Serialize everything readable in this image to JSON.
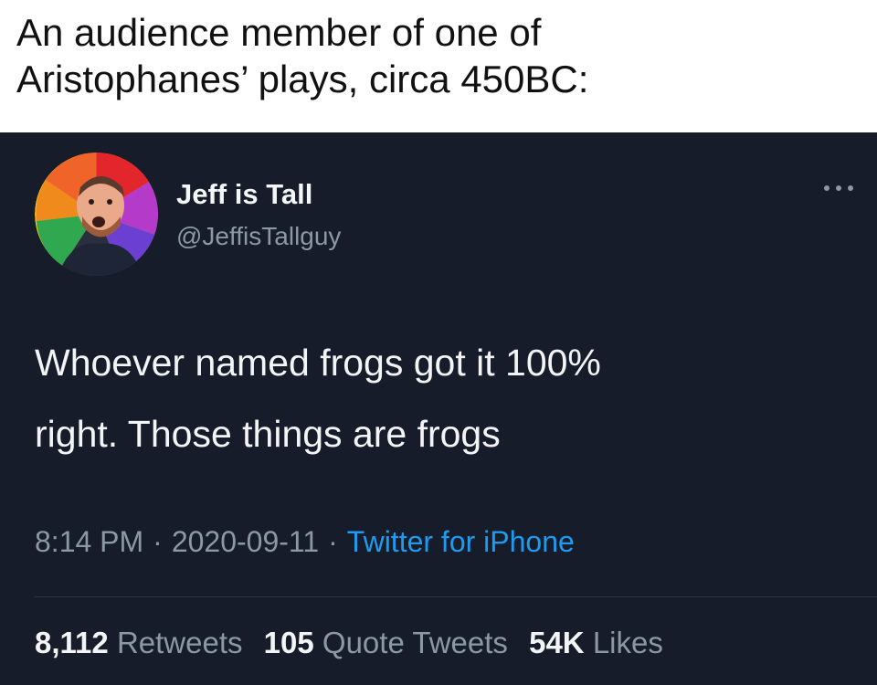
{
  "caption": {
    "line1": "An audience member of one of",
    "line2": "Aristophanes’ plays, circa 450BC:"
  },
  "tweet": {
    "display_name": "Jeff is Tall",
    "handle": "@JeffisTallguy",
    "more_icon": "ellipsis-icon",
    "text_line1": "Whoever named frogs got it 100%",
    "text_line2": "right. Those things are frogs",
    "time": "8:14 PM",
    "date": "2020-09-11",
    "separator": "·",
    "source": "Twitter for iPhone",
    "stats": {
      "retweets_count": "8,112",
      "retweets_label": "Retweets",
      "quotes_count": "105",
      "quotes_label": "Quote Tweets",
      "likes_count": "54K",
      "likes_label": "Likes"
    }
  },
  "colors": {
    "tweet_background": "#161c29",
    "link_blue": "#1d9bf0",
    "muted_text": "#8b98a5"
  }
}
